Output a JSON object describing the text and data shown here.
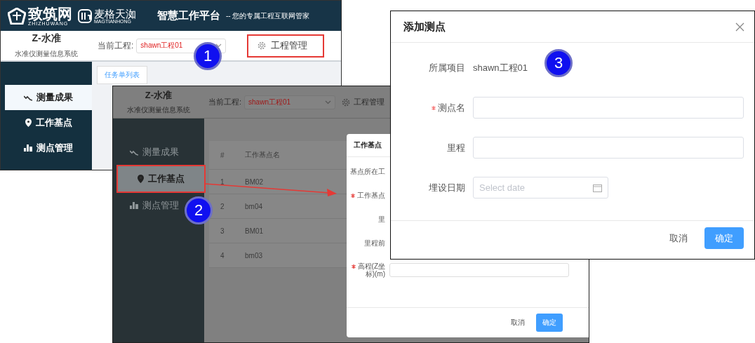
{
  "window1": {
    "logo": "致筑网",
    "logo_sub": "ZHIZHUWANG",
    "brand": "麦格天洳",
    "brand_sub": "MAGTIANHONG",
    "platform": "智慧工作平台",
    "slogan": "-- 您的专属工程互联网管家",
    "app_title": "Z-水准",
    "app_subtitle": "水准仪测量信息系统",
    "project_label": "当前工程:",
    "project_value": "shawn工程01",
    "manage": {
      "label": "工程管理",
      "highlighted": true
    },
    "menu": [
      {
        "label": "测量成果",
        "kind": "trend",
        "selected": true
      },
      {
        "label": "工作基点",
        "kind": "pin",
        "selected": false
      },
      {
        "label": "测点管理",
        "kind": "bars",
        "selected": false
      }
    ],
    "tabs": [
      {
        "label": "任务单列表",
        "selected": true
      }
    ]
  },
  "window2": {
    "app_title": "Z-水准",
    "app_subtitle": "水准仪测量信息系统",
    "project_label": "当前工程:",
    "project_value": "shawn工程01",
    "manage": {
      "label": "工程管理",
      "highlighted": false
    },
    "menu": [
      {
        "label": "测量成果",
        "kind": "trend",
        "selected": false
      },
      {
        "label": "工作基点",
        "kind": "pin",
        "selected": true
      },
      {
        "label": "测点管理",
        "kind": "bars",
        "selected": false
      }
    ],
    "table": {
      "columns": [
        "#",
        "工作基点名"
      ],
      "rows": [
        [
          "1",
          "BM02"
        ],
        [
          "2",
          "bm04"
        ],
        [
          "3",
          "BM01"
        ],
        [
          "4",
          "bm03"
        ]
      ]
    },
    "dialog": {
      "title": "工作基点",
      "fields": [
        {
          "kind": "label",
          "label": "基点所在工",
          "required": false
        },
        {
          "kind": "label",
          "label": "工作基点",
          "required": true
        },
        {
          "kind": "label",
          "label": "里",
          "required": false
        },
        {
          "kind": "label",
          "label": "里程前",
          "required": false
        },
        {
          "kind": "input",
          "label": "高程(Z坐标)(m)",
          "required": true
        }
      ],
      "cancel": "取消",
      "ok": "确定"
    }
  },
  "dialog": {
    "title": "添加测点",
    "fields": [
      {
        "kind": "text",
        "label": "所属项目",
        "value": "shawn工程01",
        "required": false
      },
      {
        "kind": "input",
        "label": "测点名",
        "required": true
      },
      {
        "kind": "input",
        "label": "里程",
        "required": false
      },
      {
        "kind": "date",
        "label": "埋设日期",
        "placeholder": "Select date",
        "required": false
      }
    ],
    "cancel": "取消",
    "ok": "确定"
  },
  "callouts": [
    {
      "number": "1"
    },
    {
      "number": "2"
    },
    {
      "number": "3"
    }
  ]
}
